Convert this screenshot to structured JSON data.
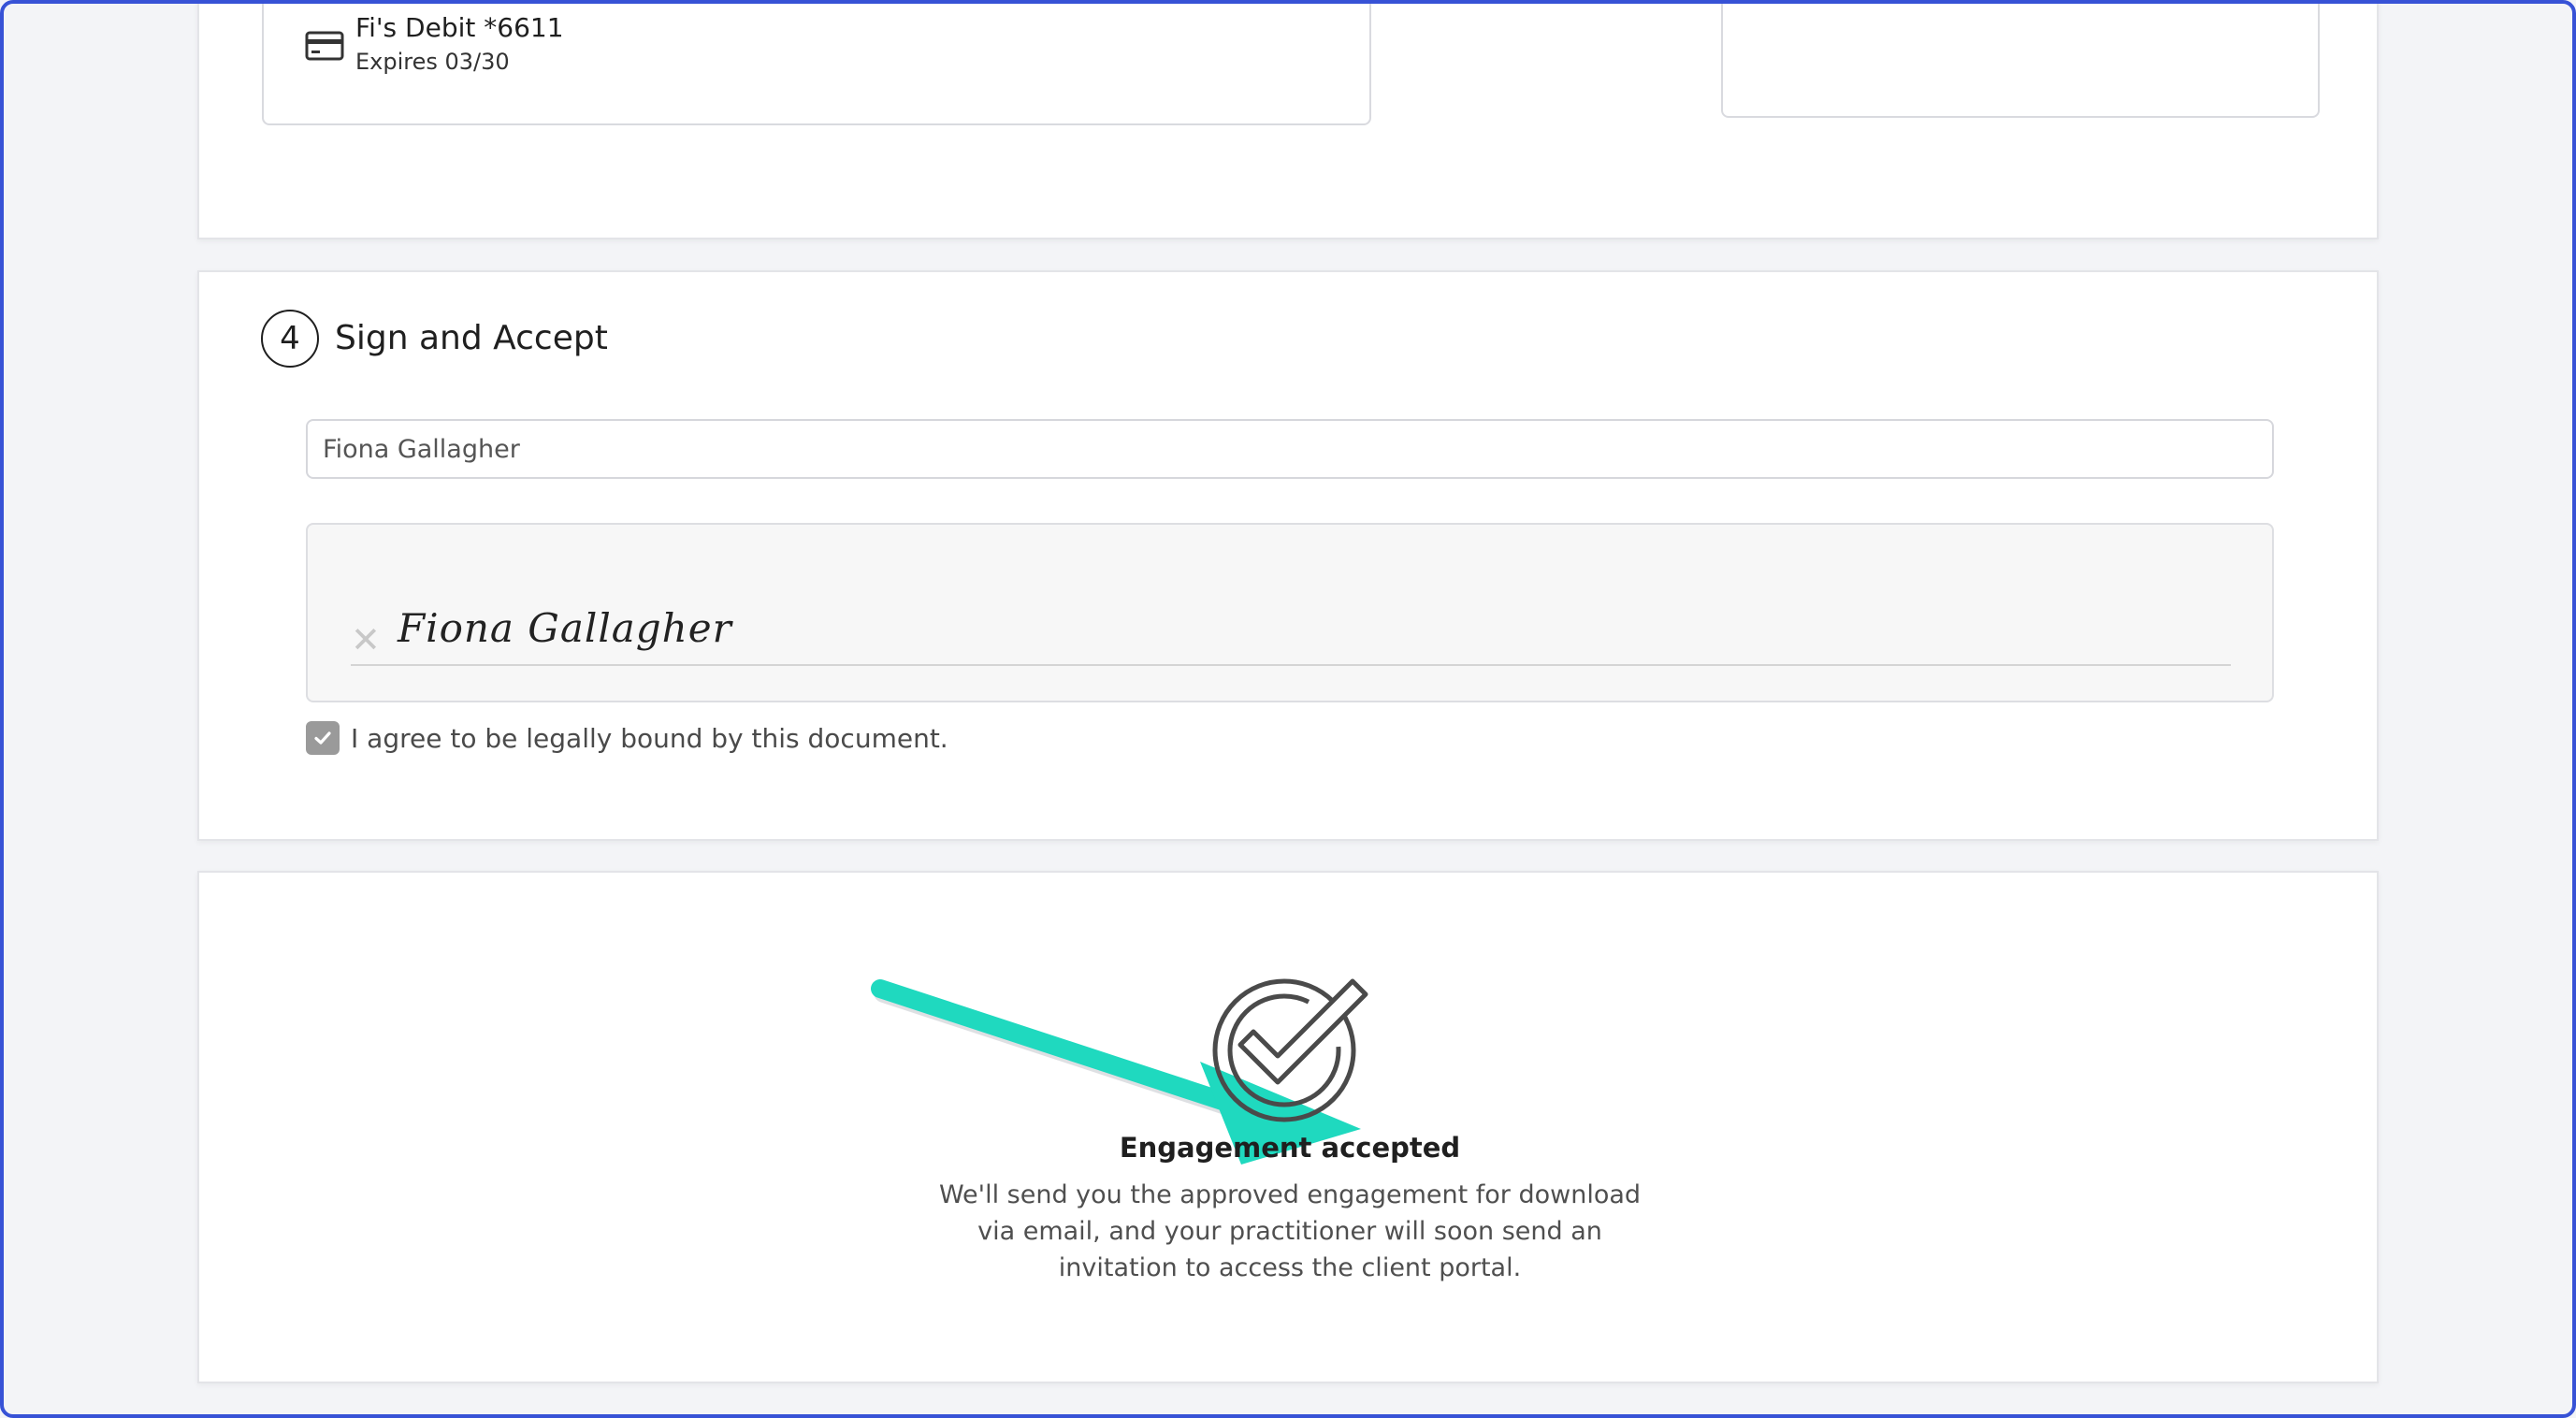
{
  "payment": {
    "card_name": "Fi's Debit *6611",
    "expires": "Expires 03/30",
    "icon": "credit-card-icon"
  },
  "sign_section": {
    "step_number": "4",
    "title": "Sign and Accept",
    "name_value": "Fiona Gallagher",
    "signature": "Fiona Gallagher",
    "clear_icon": "close-icon",
    "agree_label": "I agree to be legally bound by this document.",
    "agree_checked": true
  },
  "confirmation": {
    "icon": "check-circle-icon",
    "annotation": "arrow-icon",
    "title": "Engagement accepted",
    "message": "We'll send you the approved engagement for download via email, and your practitioner will soon send an invitation to access the client portal."
  },
  "colors": {
    "accent_frame": "#3752d6",
    "arrow": "#1fd9bf",
    "checkbox": "#9a9a9a"
  }
}
